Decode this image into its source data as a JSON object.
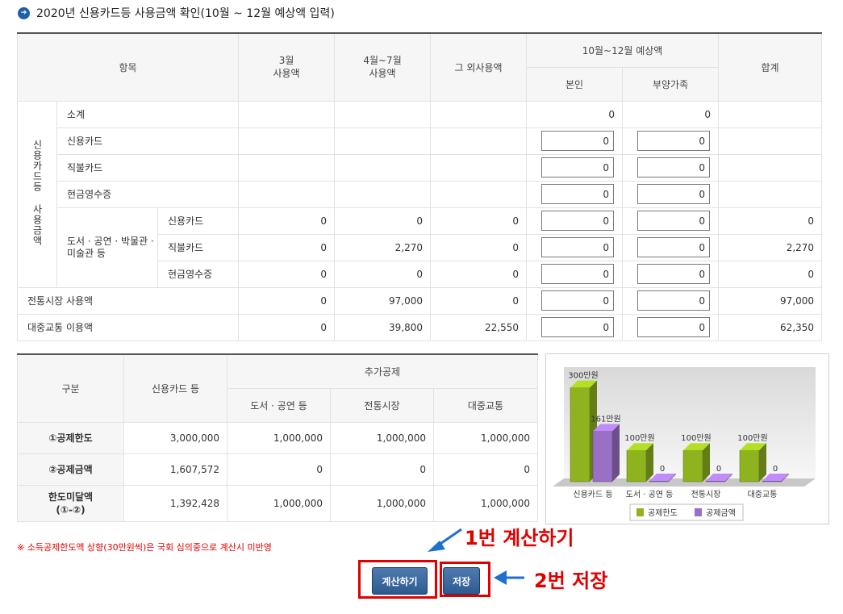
{
  "title": "2020년 신용카드등 사용금액 확인(10월 ~ 12월 예상액 입력)",
  "top_table": {
    "headers": {
      "item": "항목",
      "sep": "3월\n사용액",
      "aprjul": "4월~7월\n사용액",
      "other": "그 외사용액",
      "forecast": "10월~12월 예상액",
      "self": "본인",
      "dependent": "부양가족",
      "total": "합계"
    },
    "group_label": "신용카드등 사용금액",
    "book_group": "도서 · 공연 · 박물관 · 미술관 등",
    "rows": [
      {
        "label": "소계",
        "sep": "",
        "aprjul": "",
        "other": "",
        "self": "0",
        "dep": "0",
        "total": ""
      },
      {
        "label": "신용카드",
        "sep": "",
        "aprjul": "",
        "other": "",
        "self": "0",
        "dep": "0",
        "total": ""
      },
      {
        "label": "직불카드",
        "sep": "",
        "aprjul": "",
        "other": "",
        "self": "0",
        "dep": "0",
        "total": ""
      },
      {
        "label": "현금영수증",
        "sep": "",
        "aprjul": "",
        "other": "",
        "self": "0",
        "dep": "0",
        "total": ""
      },
      {
        "label": "신용카드",
        "sep": "0",
        "aprjul": "0",
        "other": "0",
        "self": "0",
        "dep": "0",
        "total": "0"
      },
      {
        "label": "직불카드",
        "sep": "0",
        "aprjul": "2,270",
        "other": "0",
        "self": "0",
        "dep": "0",
        "total": "2,270"
      },
      {
        "label": "현금영수증",
        "sep": "0",
        "aprjul": "0",
        "other": "0",
        "self": "0",
        "dep": "0",
        "total": "0"
      },
      {
        "label": "전통시장 사용액",
        "sep": "0",
        "aprjul": "97,000",
        "other": "0",
        "self": "0",
        "dep": "0",
        "total": "97,000"
      },
      {
        "label": "대중교통 이용액",
        "sep": "0",
        "aprjul": "39,800",
        "other": "22,550",
        "self": "0",
        "dep": "0",
        "total": "62,350"
      }
    ]
  },
  "bottom_table": {
    "headers": {
      "div": "구분",
      "credit": "신용카드 등",
      "extra": "추가공제",
      "book": "도서 · 공연 등",
      "market": "전통시장",
      "transit": "대중교통"
    },
    "rows": [
      {
        "label": "①공제한도",
        "credit": "3,000,000",
        "book": "1,000,000",
        "market": "1,000,000",
        "transit": "1,000,000"
      },
      {
        "label": "②공제금액",
        "credit": "1,607,572",
        "book": "0",
        "market": "0",
        "transit": "0"
      },
      {
        "label": "한도미달액\n(①-②)",
        "credit": "1,392,428",
        "book": "1,000,000",
        "market": "1,000,000",
        "transit": "1,000,000"
      }
    ]
  },
  "chart_data": {
    "type": "bar",
    "categories": [
      "신용카드 등",
      "도서 · 공연 등",
      "전통시장",
      "대중교통"
    ],
    "series": [
      {
        "name": "공제한도",
        "values": [
          300,
          100,
          100,
          100
        ],
        "labels": [
          "300만원",
          "100만원",
          "100만원",
          "100만원"
        ],
        "color": "#8fb31f"
      },
      {
        "name": "공제금액",
        "values": [
          161,
          0,
          0,
          0
        ],
        "labels": [
          "161만원",
          "0",
          "0",
          "0"
        ],
        "color": "#9a6fc6"
      }
    ],
    "ylim": [
      0,
      330
    ],
    "legend": "bottom"
  },
  "note": "※ 소득공제한도액 상향(30만원씩)은 국회 심의중으로 계산시 미반영",
  "buttons": {
    "calc": "계산하기",
    "save": "저장"
  },
  "annotations": {
    "step1": "1번 계산하기",
    "step2": "2번 저장"
  },
  "colors": {
    "accent": "#1f5fa8",
    "highlight": "#e00000",
    "button": "#2d5a90"
  }
}
